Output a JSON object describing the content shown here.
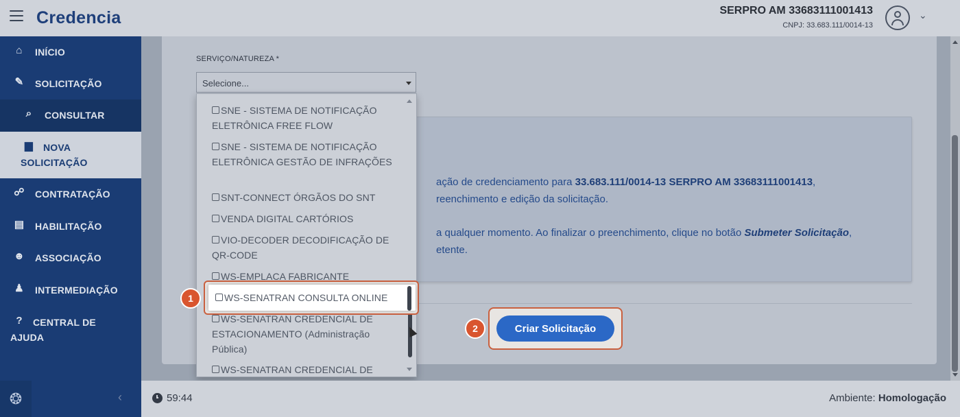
{
  "app": {
    "logo": "Credencia"
  },
  "header": {
    "user_name": "SERPRO AM 33683111001413",
    "user_cnpj": "CNPJ: 33.683.111/0014-13"
  },
  "sidebar": {
    "items": [
      {
        "label": "INÍCIO",
        "icon": "home-icon"
      },
      {
        "label": "SOLICITAÇÃO",
        "icon": "edit-icon"
      },
      {
        "label": "CONSULTAR",
        "icon": "search-icon"
      },
      {
        "label": "NOVA SOLICITAÇÃO",
        "icon": "file-icon"
      },
      {
        "label": "CONTRATAÇÃO",
        "icon": "handshake-icon"
      },
      {
        "label": "HABILITAÇÃO",
        "icon": "id-card-icon"
      },
      {
        "label": "ASSOCIAÇÃO",
        "icon": "users-icon"
      },
      {
        "label": "INTERMEDIAÇÃO",
        "icon": "user-tie-icon"
      },
      {
        "label": "CENTRAL DE AJUDA",
        "icon": "help-icon"
      }
    ]
  },
  "form": {
    "service_label": "SERVIÇO/NATUREZA *",
    "select_placeholder": "Selecione...",
    "create_button": "Criar Solicitação"
  },
  "info": {
    "line1_pre": "ação de credenciamento para ",
    "line1_bold": "33.683.111/0014-13 SERPRO AM 33683111001413",
    "line1_post": ",",
    "line2": "reenchimento e edição da solicitação.",
    "line3_pre": "a qualquer momento. Ao finalizar o preenchimento, clique no botão ",
    "line3_em": "Submeter Solicitação",
    "line3_post": ",",
    "line4": "etente."
  },
  "dropdown": {
    "options": [
      "SNE - SISTEMA DE NOTIFICAÇÃO ELETRÔNICA FREE FLOW",
      "SNE - SISTEMA DE NOTIFICAÇÃO ELETRÔNICA GESTÃO DE INFRAÇÕES",
      "SNT-CONNECT ÓRGÃOS DO SNT",
      "VENDA DIGITAL CARTÓRIOS",
      "VIO-DECODER DECODIFICAÇÃO DE QR-CODE",
      "WS-EMPLACA FABRICANTE",
      "WS-SENATRAN CONSULTA ONLINE",
      "WS-SENATRAN CREDENCIAL DE ESTACIONAMENTO (Administração Pública)",
      "WS-SENATRAN CREDENCIAL DE"
    ]
  },
  "annotations": {
    "step1": "1",
    "step2": "2"
  },
  "footer": {
    "timer": "59:44",
    "env_label": "Ambiente: ",
    "env_value": "Homologação"
  },
  "colors": {
    "sidebar": "#1a3c74",
    "accent_button": "#2b68c6",
    "annotation": "#d9552f"
  }
}
